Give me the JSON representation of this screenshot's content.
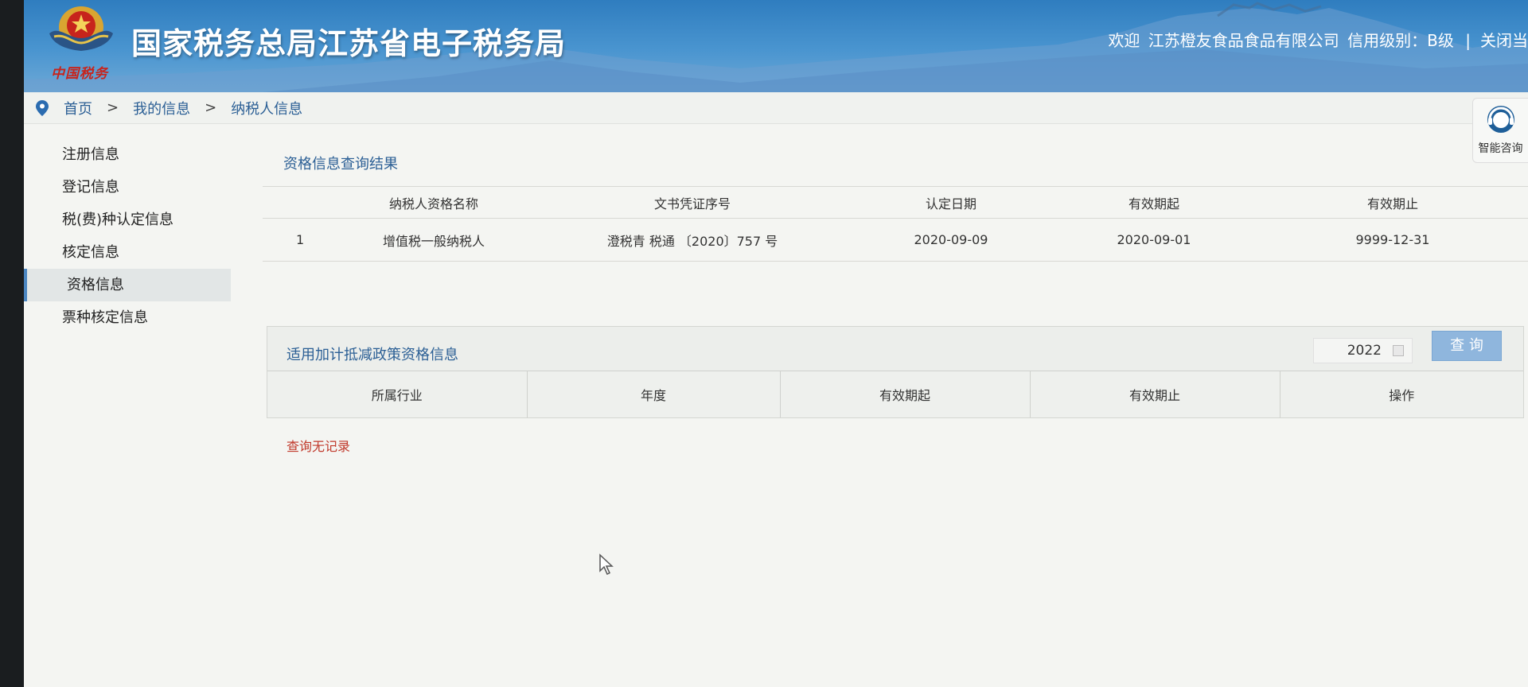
{
  "header": {
    "brand_script": "中国税务",
    "title": "国家税务总局江苏省电子税务局",
    "welcome": "欢迎",
    "company": "江苏橙友食品食品有限公司",
    "credit": "信用级别：B级",
    "close_link": "关闭当"
  },
  "breadcrumb": {
    "home": "首页",
    "sep1": ">",
    "my_info": "我的信息",
    "sep2": ">",
    "current": "纳税人信息"
  },
  "sidebar": {
    "items": [
      {
        "label": "注册信息"
      },
      {
        "label": "登记信息"
      },
      {
        "label": "税(费)种认定信息"
      },
      {
        "label": "核定信息"
      },
      {
        "label": "资格信息"
      },
      {
        "label": "票种核定信息"
      }
    ],
    "active_index": 4
  },
  "consult": {
    "label": "智能咨询"
  },
  "result": {
    "title": "资格信息查询结果",
    "columns": [
      "",
      "纳税人资格名称",
      "文书凭证序号",
      "认定日期",
      "有效期起",
      "有效期止"
    ],
    "rows": [
      [
        "1",
        "增值税一般纳税人",
        "澄税青 税通 〔2020〕757 号",
        "2020-09-09",
        "2020-09-01",
        "9999-12-31"
      ]
    ]
  },
  "policy": {
    "title": "适用加计抵减政策资格信息",
    "year_value": "2022",
    "query_label": "查 询",
    "columns": [
      "所属行业",
      "年度",
      "有效期起",
      "有效期止",
      "操作"
    ],
    "empty_text": "查询无记录"
  },
  "colors": {
    "accent": "#2b5f95",
    "header_blue": "#3f8bc9",
    "error_red": "#c0392b",
    "button_blue": "#8fb6dd"
  }
}
